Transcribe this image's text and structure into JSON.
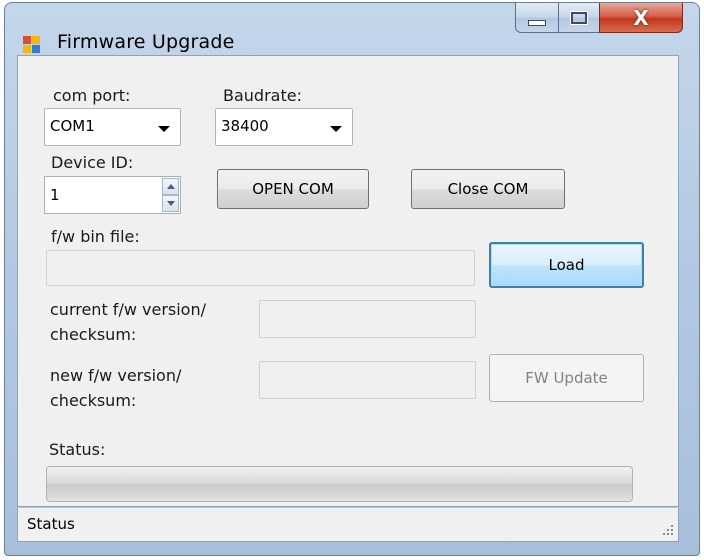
{
  "window": {
    "title": "Firmware Upgrade",
    "close_glyph": "X"
  },
  "form": {
    "com_port_label": "com port:",
    "com_port_value": "COM1",
    "baudrate_label": "Baudrate:",
    "baudrate_value": "38400",
    "device_id_label": "Device ID:",
    "device_id_value": "1",
    "open_com_label": "OPEN COM",
    "close_com_label": "Close COM",
    "fw_bin_label": "f/w bin file:",
    "fw_bin_value": "",
    "load_label": "Load",
    "current_version_label_line1": "current f/w version/",
    "current_version_label_line2": "checksum:",
    "current_version_value": "",
    "new_version_label_line1": "new f/w version/",
    "new_version_label_line2": "checksum:",
    "new_version_value": "",
    "fw_update_label": "FW Update",
    "status_label": "Status:",
    "progress_percent": 0
  },
  "statusbar": {
    "text": "Status"
  },
  "icons": [
    "app-icon",
    "minimize-icon",
    "maximize-icon",
    "close-icon",
    "spin-up-icon",
    "spin-down-icon",
    "dropdown-arrow-icon",
    "resize-grip-icon"
  ]
}
